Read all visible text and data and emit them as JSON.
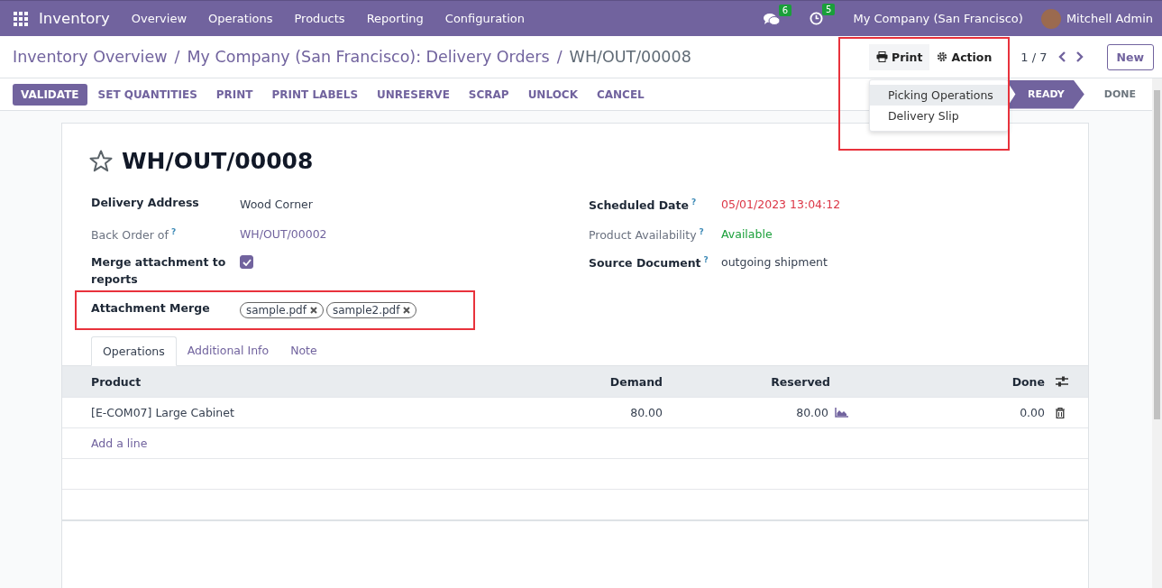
{
  "navbar": {
    "app": "Inventory",
    "menus": [
      "Overview",
      "Operations",
      "Products",
      "Reporting",
      "Configuration"
    ],
    "messages_count": "6",
    "activities_count": "5",
    "company": "My Company (San Francisco)",
    "user": "Mitchell Admin"
  },
  "breadcrumbs": [
    {
      "label": "Inventory Overview"
    },
    {
      "separator": "/",
      "label": "My Company (San Francisco): Delivery Orders"
    },
    {
      "separator": "/",
      "label": "WH/OUT/00008"
    }
  ],
  "control_panel": {
    "print": "Print",
    "action": "Action",
    "pager": "1 / 7",
    "new": "New"
  },
  "print_menu": [
    {
      "label": "Picking Operations",
      "selected": true
    },
    {
      "label": "Delivery Slip",
      "selected": false
    }
  ],
  "buttons": [
    {
      "label": "VALIDATE",
      "kind": "primary"
    },
    {
      "label": "SET QUANTITIES",
      "kind": "secondary"
    },
    {
      "label": "PRINT",
      "kind": "secondary"
    },
    {
      "label": "PRINT LABELS",
      "kind": "secondary"
    },
    {
      "label": "UNRESERVE",
      "kind": "secondary"
    },
    {
      "label": "SCRAP",
      "kind": "secondary"
    },
    {
      "label": "UNLOCK",
      "kind": "secondary"
    },
    {
      "label": "CANCEL",
      "kind": "secondary"
    }
  ],
  "stages": [
    {
      "label": "READY",
      "selected": true
    },
    {
      "label": "DONE",
      "selected": false
    }
  ],
  "record": {
    "title": "WH/OUT/00008",
    "starred": false
  },
  "fields_left": [
    {
      "label": "Delivery Address",
      "kind": "text",
      "value": "Wood Corner",
      "muted": false
    },
    {
      "label": "Back Order of",
      "help": "?",
      "kind": "link",
      "value": "WH/OUT/00002",
      "muted": true
    },
    {
      "label": "Merge attachment to reports",
      "kind": "checkbox",
      "checked": true,
      "muted": false
    },
    {
      "label": "Attachment Merge",
      "kind": "tags",
      "tags": [
        "sample.pdf",
        "sample2.pdf"
      ],
      "muted": false
    }
  ],
  "fields_right": [
    {
      "label": "Scheduled Date",
      "help": "?",
      "kind": "late",
      "value": "05/01/2023 13:04:12",
      "muted": false
    },
    {
      "label": "Product Availability",
      "help": "?",
      "kind": "available",
      "value": "Available",
      "muted": true
    },
    {
      "label": "Source Document",
      "help": "?",
      "kind": "text",
      "value": "outgoing shipment",
      "muted": false
    }
  ],
  "tabs": [
    {
      "label": "Operations",
      "selected": true
    },
    {
      "label": "Additional Info",
      "selected": false
    },
    {
      "label": "Note",
      "selected": false
    }
  ],
  "table": {
    "columns": [
      "Product",
      "Demand",
      "Reserved",
      "Done"
    ],
    "rows": [
      {
        "product": "[E-COM07] Large Cabinet",
        "demand": "80.00",
        "reserved": "80.00",
        "done": "0.00"
      }
    ],
    "add_line": "Add a line"
  }
}
